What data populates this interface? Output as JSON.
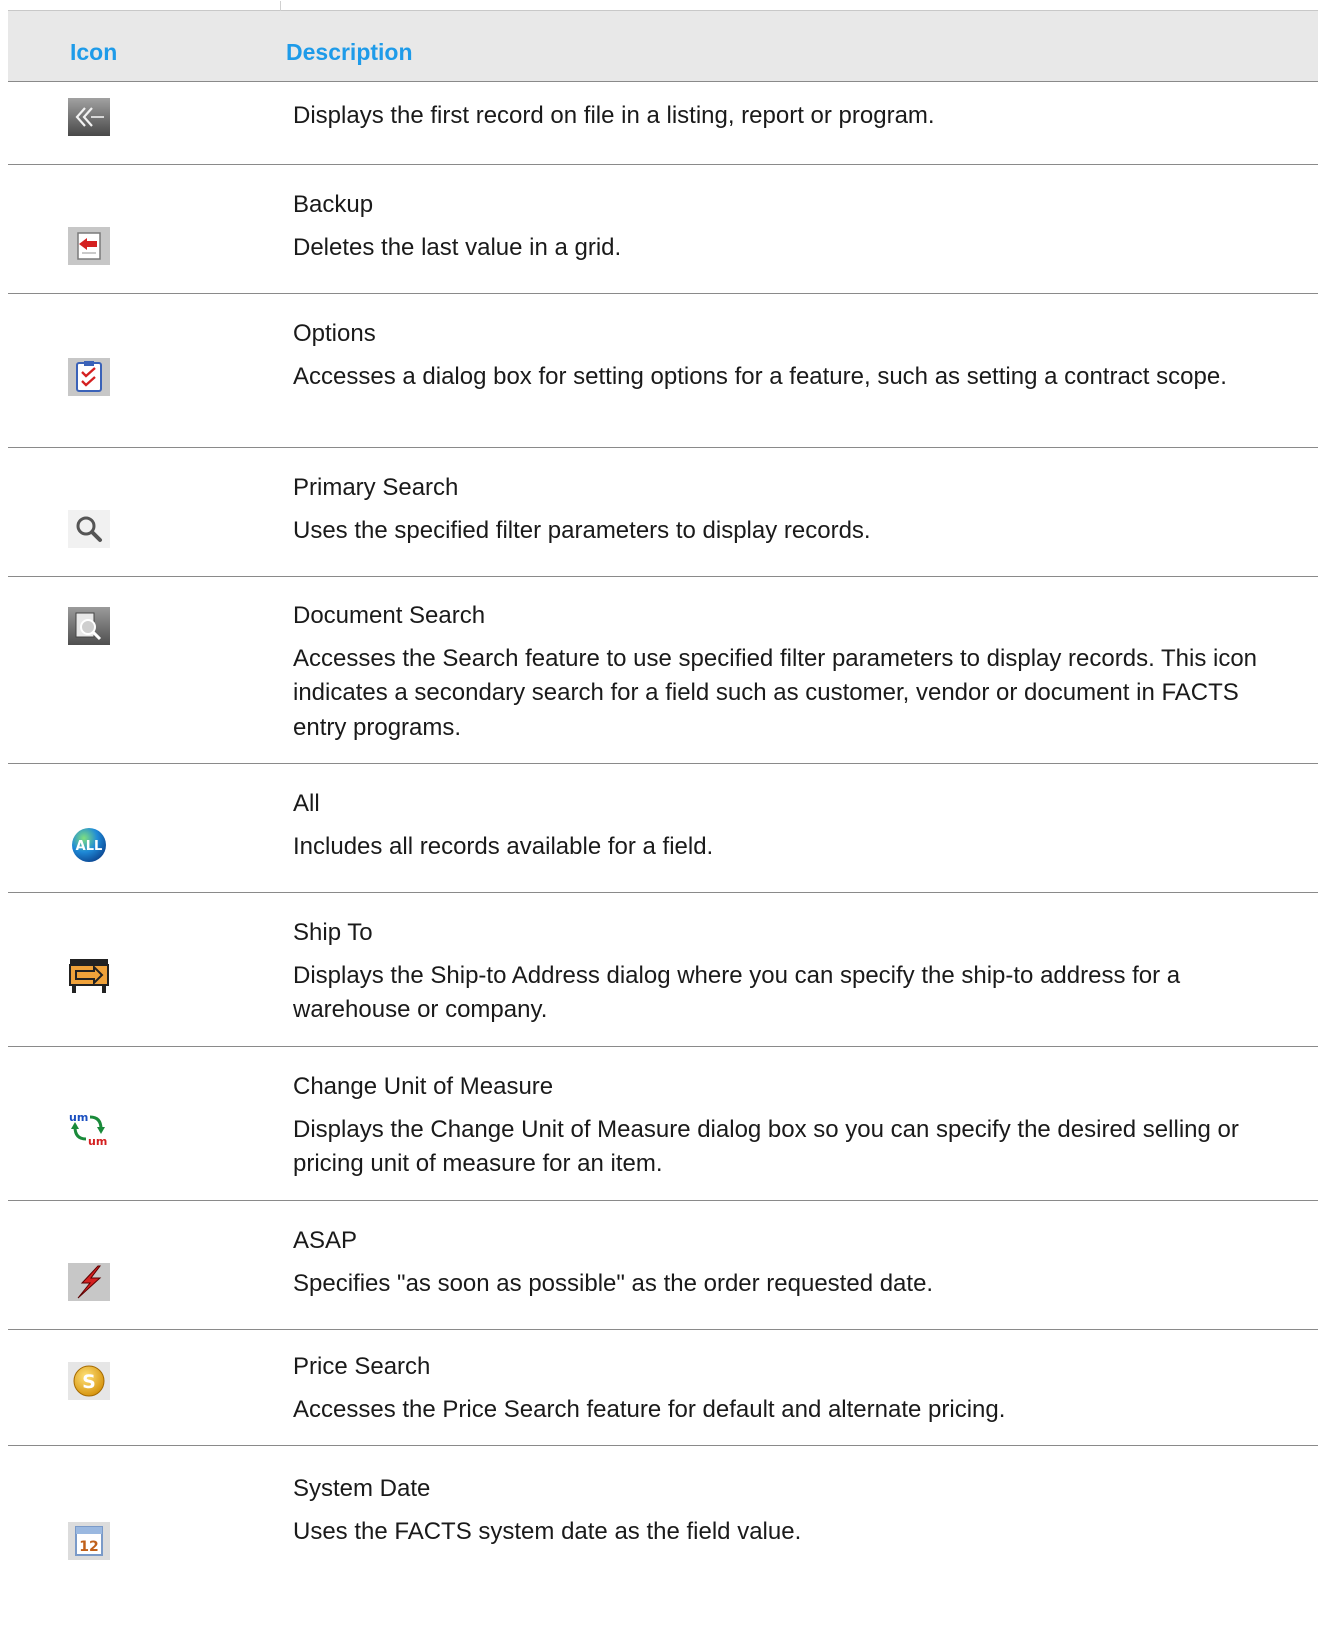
{
  "header": {
    "icon_col": "Icon",
    "desc_col": "Description"
  },
  "rows": [
    {
      "icon": "first-record-icon",
      "title": "",
      "desc": "Displays the first record on file in a listing, report or program."
    },
    {
      "icon": "backup-icon",
      "title": "Backup",
      "desc": "Deletes the last value in a grid."
    },
    {
      "icon": "options-icon",
      "title": "Options",
      "desc": "Accesses a dialog box for setting options for a feature, such as setting a contract scope."
    },
    {
      "icon": "search-icon",
      "title": "Primary Search",
      "desc": "Uses the specified filter parameters to display records."
    },
    {
      "icon": "document-search-icon",
      "title": "Document Search",
      "desc": "Accesses the Search feature to use specified filter parameters to display records. This icon indicates a secondary search for a field such as customer, vendor or document in FACTS entry programs."
    },
    {
      "icon": "all-icon",
      "title": "All",
      "desc": "Includes all records available for a field."
    },
    {
      "icon": "ship-to-icon",
      "title": "Ship To",
      "desc": "Displays the Ship-to Address dialog where you can specify the ship-to address for a warehouse or company."
    },
    {
      "icon": "change-unit-of-measure-icon",
      "title": "Change Unit of Measure",
      "desc": "Displays the Change Unit of Measure dialog box so you can specify the desired selling or pricing unit of measure for an item."
    },
    {
      "icon": "asap-icon",
      "title": "ASAP",
      "desc": "Specifies \"as soon as possible\" as the order requested date."
    },
    {
      "icon": "price-search-icon",
      "title": "Price Search",
      "desc": "Accesses the Price Search feature for default and alternate pricing."
    },
    {
      "icon": "system-date-icon",
      "title": "System Date",
      "desc": "Uses the FACTS system date as the field value."
    }
  ],
  "colors": {
    "header_text": "#1e9be9",
    "header_bg": "#e8e8e8",
    "rule": "#8a8a8a"
  }
}
